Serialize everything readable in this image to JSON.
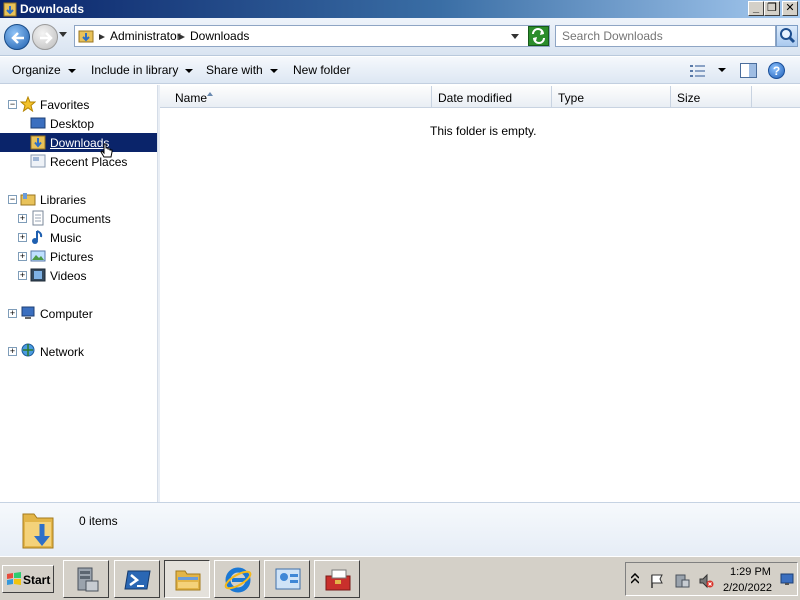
{
  "window": {
    "title": "Downloads"
  },
  "titlebar_buttons": {
    "minimize": "_",
    "restore": "❐",
    "close": "✕"
  },
  "address": {
    "crumbs": [
      "Administrator",
      "Downloads"
    ]
  },
  "search": {
    "placeholder": "Search Downloads"
  },
  "commands": {
    "organize": "Organize",
    "include": "Include in library",
    "share": "Share with",
    "new_folder": "New folder",
    "help": "?"
  },
  "nav": {
    "favorites": "Favorites",
    "desktop": "Desktop",
    "downloads": "Downloads",
    "recent": "Recent Places",
    "libraries": "Libraries",
    "documents": "Documents",
    "music": "Music",
    "pictures": "Pictures",
    "videos": "Videos",
    "computer": "Computer",
    "network": "Network"
  },
  "columns": [
    "Name",
    "Date modified",
    "Type",
    "Size"
  ],
  "empty_message": "This folder is empty.",
  "details": {
    "item_count": "0 items"
  },
  "taskbar": {
    "start": "Start",
    "time": "1:29 PM",
    "date": "2/20/2022"
  },
  "colors": {
    "selection": "#0a246a",
    "title_start": "#0a246a",
    "title_end": "#a6caf0",
    "taskbar": "#d4d0c8"
  }
}
